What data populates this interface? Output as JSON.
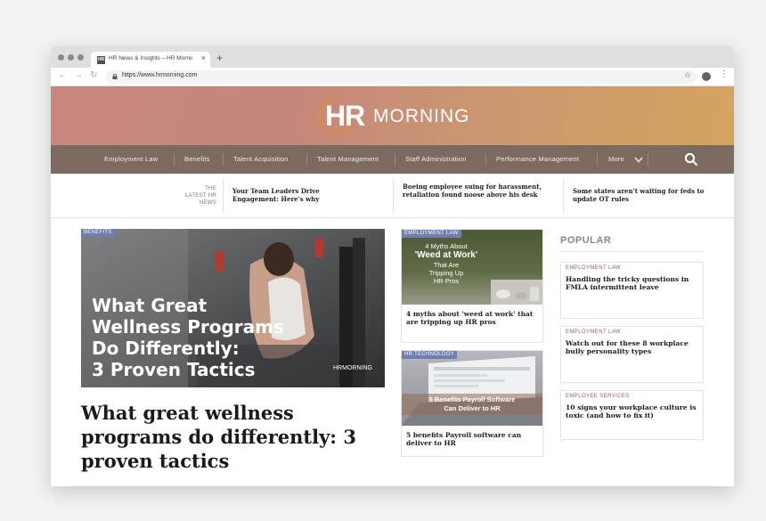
{
  "browser": {
    "tab_title": "HR News & Insights – HR Morning",
    "tab_favicon": "HR",
    "tab_close": "×",
    "new_tab": "+",
    "url": "https://www.hrmorning.com",
    "icons": [
      "back-arrow-icon",
      "forward-arrow-icon",
      "reload-icon",
      "lock-icon",
      "star-icon",
      "account-icon",
      "kebab-menu-icon"
    ]
  },
  "site": {
    "logo_hr": "HR",
    "logo_morning": "MORNING",
    "nav": [
      "Employment Law",
      "Benefits",
      "Talent Acquisition",
      "Talent Management",
      "Staff Administration",
      "Performance Management",
      "More"
    ],
    "search_icon": "search-icon"
  },
  "ticker": {
    "label": [
      "THE",
      "LATEST HR",
      "NEWS"
    ],
    "items": [
      "Your Team Leaders Drive Engagement: Here's why",
      "Boeing employee suing for harassment, retaliation found noose above his desk",
      "Some states aren't waiting for feds to update OT rules"
    ]
  },
  "hero": {
    "category": "BENEFITS",
    "image_text": [
      "What Great",
      "Wellness Programs",
      "Do Differently:",
      "3 Proven Tactics"
    ],
    "image_logo": "HRMORNING",
    "headline": "What great wellness programs do differently: 3 proven tactics"
  },
  "cards": [
    {
      "category": "EMPLOYMENT LAW",
      "image_text": [
        "4 Myths About",
        "'Weed at Work'",
        "That Are",
        "Tripping Up",
        "HR Pros"
      ],
      "title": "4 myths about 'weed at work' that are tripping up HR pros"
    },
    {
      "category": "HR TECHNOLOGY",
      "image_text": [
        "5 Benefits Payroll Software",
        "Can Deliver to HR"
      ],
      "title": "5 benefits Payroll software can deliver to HR"
    }
  ],
  "popular": {
    "heading": "POPULAR",
    "items": [
      {
        "category": "EMPLOYMENT LAW",
        "title": "Handling the tricky questions in FMLA intermittent leave"
      },
      {
        "category": "EMPLOYMENT LAW",
        "title": "Watch out for these 8 workplace bully personality types"
      },
      {
        "category": "EMPLOYEE SERVICES",
        "title": "10 signs your workplace culture is toxic (and how to fix it)"
      }
    ]
  },
  "colors": {
    "banner_start": "#c8877d",
    "banner_end": "#d4a45e",
    "navbar": "#7a6a60",
    "category_badge": "#6f7fae",
    "popular_category": "#9a5f55"
  }
}
